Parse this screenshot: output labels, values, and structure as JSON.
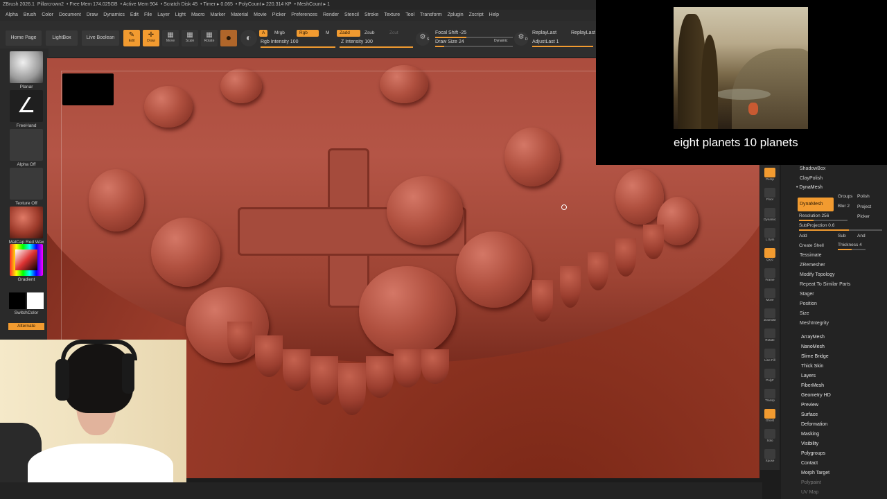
{
  "titlebar": {
    "items": [
      "ZBrush 2026.1",
      "Pillarcrown2",
      "• Free Mem 174.025GB",
      "• Active Mem 904",
      "• Scratch Disk 45",
      "• Timer ▸ 0.065",
      "• PolyCount ▸ 220.314 KP",
      "• MeshCount ▸ 1"
    ]
  },
  "menu": [
    "Alpha",
    "Brush",
    "Color",
    "Document",
    "Draw",
    "Dynamics",
    "Edit",
    "File",
    "Layer",
    "Light",
    "Macro",
    "Marker",
    "Material",
    "Movie",
    "Picker",
    "Preferences",
    "Render",
    "Stencil",
    "Stroke",
    "Texture",
    "Tool",
    "Transform",
    "Zplugin",
    "Zscript",
    "Help"
  ],
  "toolbar": {
    "home_page": "Home Page",
    "lightbox": "LightBox",
    "live_boolean": "Live Boolean",
    "edit": "Edit",
    "draw": "Draw",
    "move": "Move",
    "scale": "Scale",
    "rotate": "Rotate",
    "a_label": "A",
    "mrgb": "Mrgb",
    "rgb": "Rgb",
    "m": "M",
    "zadd": "Zadd",
    "zsub": "Zsub",
    "zcut": "Zcut",
    "rgb_intensity": "Rgb Intensity 100",
    "z_intensity": "Z Intensity 100",
    "focal_shift": "Focal Shift -25",
    "draw_size": "Draw Size 24",
    "dynamic": "Dynamic",
    "replay_last": "ReplayLast",
    "replay_last_rel": "ReplayLast",
    "adjust_last": "AdjustLast 1",
    "s_label": "S",
    "d_label": "D",
    "rgb_intensity_value": 100,
    "z_intensity_value": 100
  },
  "lefttray": {
    "planar": "Planar",
    "freehand": "FreeHand",
    "alpha_off": "Alpha Off",
    "texture_off": "Texture Off",
    "matcap": "MatCap Red Wax",
    "gradient": "Gradient",
    "switchcolor": "SwitchColor",
    "alternate": "Alternate"
  },
  "overlay": {
    "caption": "eight planets 10 planets"
  },
  "rightstrip": [
    "Persp",
    "Floor",
    "Dynamic",
    "L.Sym",
    "Qxyz",
    "Frame",
    "Move",
    "Zoom3D",
    "Rotate",
    "Line Fill",
    "PolyF",
    "Transp",
    "Ghost",
    "Solo",
    "Xpose"
  ],
  "palette": {
    "shadowbox": "ShadowBox",
    "claypolish": "ClayPolish",
    "dynamesh_header": "• DynaMesh",
    "dynamesh_btn": "DynaMesh",
    "groups": "Groups",
    "polish": "Polish",
    "blur": "Blur 2",
    "project": "Project",
    "picker": "Picker",
    "resolution": "Resolution 256",
    "subprojection": "SubProjection 0.6",
    "add": "Add",
    "sub": "Sub",
    "and": "And",
    "create_shell": "Create Shell",
    "thickness": "Thickness 4",
    "items": [
      "Tessimate",
      "ZRemesher",
      "Modify Topology",
      "Repeat To Similar Parts",
      "Stager",
      "Position",
      "Size",
      "MeshIntegrity"
    ],
    "groups_list": [
      "ArrayMesh",
      "NanoMesh",
      "Slime Bridge",
      "Thick Skin",
      "Layers",
      "FiberMesh",
      "Geometry HD",
      "Preview",
      "Surface",
      "Deformation",
      "Masking",
      "Visibility",
      "Polygroups",
      "Contact",
      "Morph Target"
    ],
    "dim_items": [
      "Polypaint",
      "UV Map"
    ]
  },
  "colors": {
    "accent": "#f29b30",
    "ui_bg": "#2b2b2b",
    "clay": "#a54b3c"
  }
}
